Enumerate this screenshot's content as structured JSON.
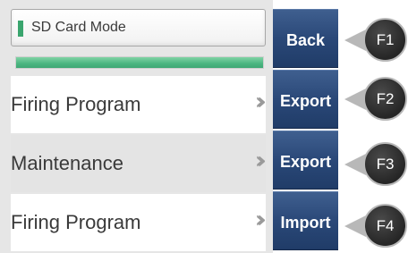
{
  "header": {
    "title": "SD Card Mode"
  },
  "progress": {
    "fraction": 1.0,
    "color": "#4bb580"
  },
  "menu": {
    "items": [
      {
        "label": "Firing Program",
        "arrows": "›››"
      },
      {
        "label": "Maintenance",
        "arrows": "›››"
      },
      {
        "label": "Firing Program",
        "arrows": "›››"
      }
    ]
  },
  "function_buttons": [
    {
      "label": "Back",
      "key": "F1"
    },
    {
      "label": "Export",
      "key": "F2"
    },
    {
      "label": "Export",
      "key": "F3"
    },
    {
      "label": "Import",
      "key": "F4"
    }
  ],
  "colors": {
    "accent_green": "#3aa56e",
    "button_blue": "#2a4878",
    "key_dark": "#262626"
  },
  "icons": {
    "row_arrow": "triple-chevron-right-icon",
    "key_pointer": "left-triangle-icon"
  }
}
